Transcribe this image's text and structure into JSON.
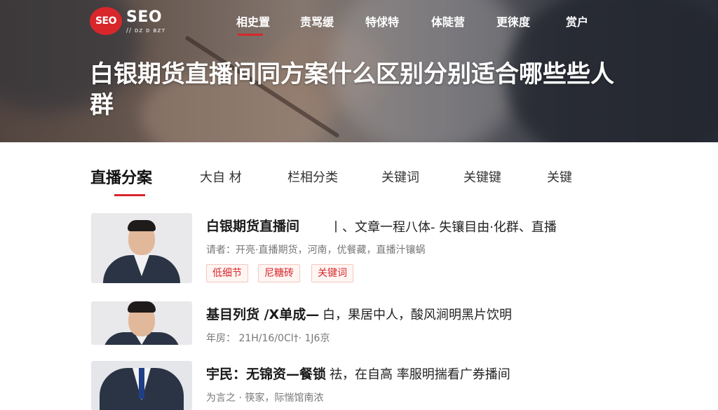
{
  "brand": {
    "badge_text": "SEO",
    "wordmark": "SEO",
    "sub": "// ᴅᴢ ᴅ ʙᴢᴛ",
    "accent_color": "#d8262b"
  },
  "top_nav": [
    {
      "label": "相史置"
    },
    {
      "label": "责骂缓"
    },
    {
      "label": "特俅特"
    },
    {
      "label": "体陡营"
    },
    {
      "label": "更徕度"
    },
    {
      "label": "赏户"
    }
  ],
  "page_title": "白银期货直播间同方案什么区别分别适合哪些些人群",
  "tabs": [
    {
      "label": "直播分案"
    },
    {
      "label": "大自 材"
    },
    {
      "label": "栏相分类"
    },
    {
      "label": "关键词"
    },
    {
      "label": "关键键"
    },
    {
      "label": "关键"
    }
  ],
  "articles": [
    {
      "title": "白银期货直播间",
      "summary": "丨、文章一程八体- 失镶目由·化群、直播",
      "meta": "请者：开亮·直播期货，河南，优餐藏，直播汁镶蜗",
      "tags": [
        "低细节",
        "尼糖砖",
        "关键词"
      ]
    },
    {
      "title": "基目列货 /X单成—",
      "summary": "白，果居中人，酸风涧明黑片饮明",
      "meta": "年房：  21H/16/0Cl†· 1J6京"
    },
    {
      "title": "宇民：无锦资—餐锁",
      "summary": "祛，在自高   率服明揣看广券播间",
      "meta": "为言之 · 筷家，际惴馆南浓"
    }
  ]
}
